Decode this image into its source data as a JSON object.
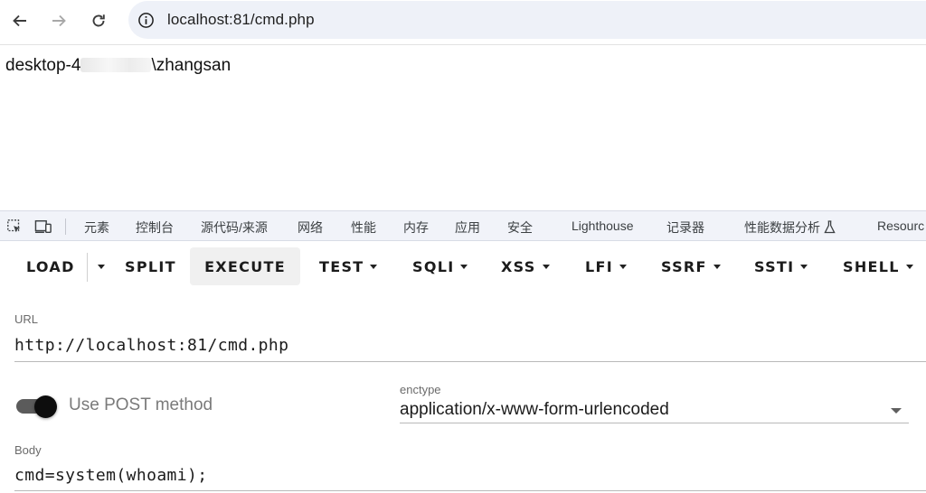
{
  "browser": {
    "url": "localhost:81/cmd.php"
  },
  "page": {
    "output_prefix": "desktop-4",
    "output_suffix": "\\zhangsan"
  },
  "devtools": {
    "tabs": [
      "元素",
      "控制台",
      "源代码/来源",
      "网络",
      "性能",
      "内存",
      "应用",
      "安全",
      "Lighthouse",
      "记录器",
      "性能数据分析",
      "Resourc"
    ]
  },
  "hackbar": {
    "buttons": {
      "load": "LOAD",
      "split": "SPLIT",
      "execute": "EXECUTE",
      "test": "TEST",
      "sqli": "SQLI",
      "xss": "XSS",
      "lfi": "LFI",
      "ssrf": "SSRF",
      "ssti": "SSTI",
      "shell": "SHELL"
    },
    "url_label": "URL",
    "url_value": "http://localhost:81/cmd.php",
    "post_toggle_label": "Use POST method",
    "post_enabled": true,
    "enctype_label": "enctype",
    "enctype_value": "application/x-www-form-urlencoded",
    "body_label": "Body",
    "body_value": "cmd=system(whoami);"
  },
  "colors": {
    "omnibox_bg": "#eef1f8",
    "devtools_bar_bg": "#f1f3f9",
    "active_button_bg": "#f0f0f0"
  }
}
